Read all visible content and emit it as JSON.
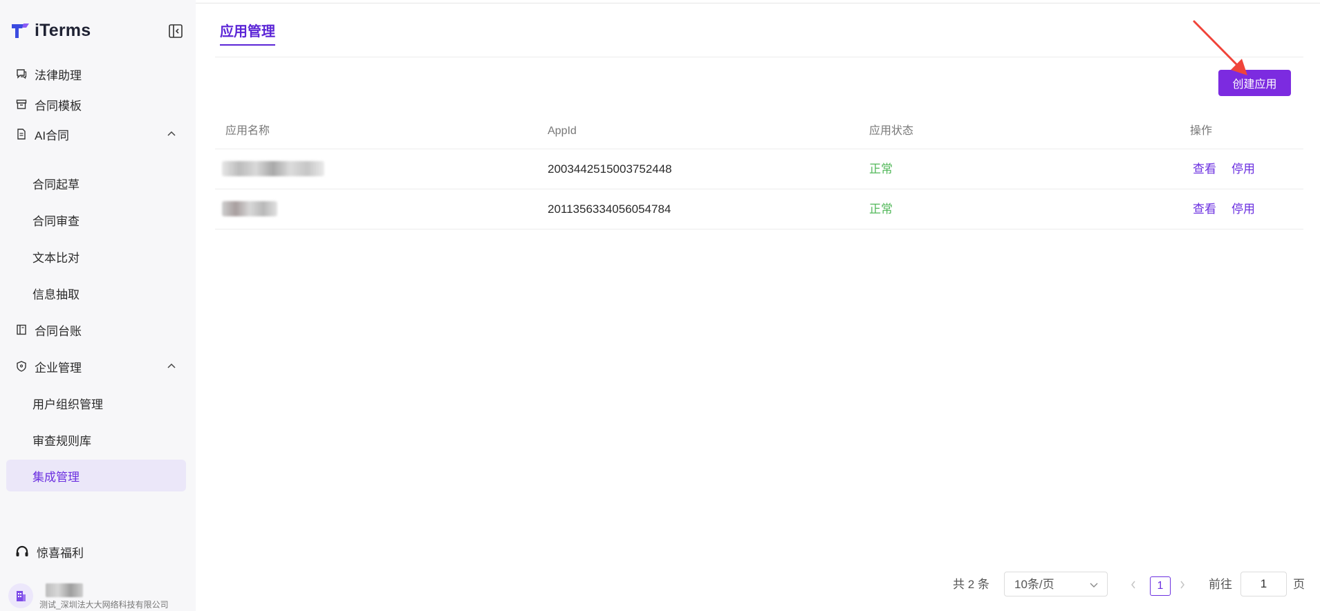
{
  "app": {
    "name": "iTerms"
  },
  "sidebar": {
    "items": [
      {
        "label": "法律助理",
        "icon": "chat-icon"
      },
      {
        "label": "合同模板",
        "icon": "archive-icon"
      },
      {
        "label": "AI合同",
        "icon": "document-icon",
        "expanded": true,
        "children": [
          "合同起草",
          "合同审查",
          "文本比对",
          "信息抽取"
        ]
      },
      {
        "label": "合同台账",
        "icon": "book-icon"
      },
      {
        "label": "企业管理",
        "icon": "shield-icon",
        "expanded": true,
        "children": [
          "用户组织管理",
          "审查规则库",
          "集成管理"
        ]
      }
    ],
    "active": "集成管理",
    "bonus": "惊喜福利",
    "org_subtitle": "测试_深圳法大大网络科技有限公司"
  },
  "main": {
    "tab": "应用管理",
    "create_button": "创建应用",
    "table": {
      "headers": [
        "应用名称",
        "AppId",
        "应用状态",
        "操作"
      ],
      "rows": [
        {
          "appid": "2003442515003752448",
          "status": "正常",
          "actions": [
            "查看",
            "停用"
          ]
        },
        {
          "appid": "2011356334056054784",
          "status": "正常",
          "actions": [
            "查看",
            "停用"
          ]
        }
      ]
    }
  },
  "pagination": {
    "total": "共 2 条",
    "page_size": "10条/页",
    "current_page": "1",
    "goto_label": "前往",
    "goto_value": "1",
    "page_suffix": "页"
  },
  "colors": {
    "accent": "#6b2fe0",
    "button": "#7c2be0",
    "status_ok": "#52b85a",
    "annotation_arrow": "#f0443a"
  }
}
